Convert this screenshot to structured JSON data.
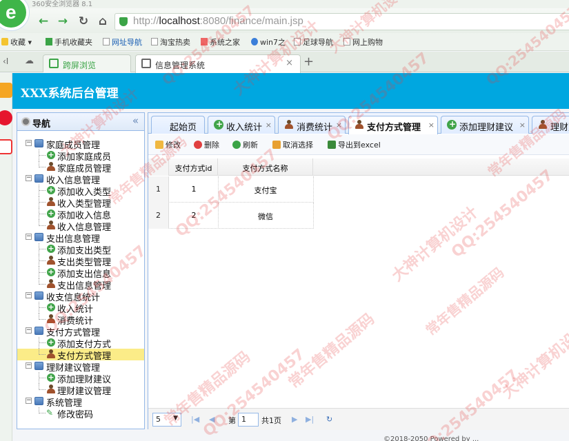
{
  "browser": {
    "title": "360安全浏览器 8.1",
    "url_prefix": "http://",
    "url_host": "localhost",
    "url_rest": ":8080/finance/main.jsp",
    "bookmarks": [
      "收藏",
      "手机收藏夹",
      "网址导航",
      "淘宝热卖",
      "系统之家",
      "win7之",
      "足球导航",
      "网上购物"
    ],
    "tabs": [
      {
        "label": "跨屏浏览"
      },
      {
        "label": "信息管理系统"
      }
    ],
    "new_tab": "+"
  },
  "app": {
    "title": "XXX系统后台管理",
    "nav": {
      "title": "导航",
      "collapse": "«",
      "groups": [
        {
          "label": "家庭成员管理",
          "items": [
            "添加家庭成员",
            "家庭成员管理"
          ]
        },
        {
          "label": "收入信息管理",
          "items": [
            "添加收入类型",
            "收入类型管理",
            "添加收入信息",
            "收入信息管理"
          ]
        },
        {
          "label": "支出信息管理",
          "items": [
            "添加支出类型",
            "支出类型管理",
            "添加支出信息",
            "支出信息管理"
          ]
        },
        {
          "label": "收支信息统计",
          "items": [
            "收入统计",
            "消费统计"
          ]
        },
        {
          "label": "支付方式管理",
          "items": [
            "添加支付方式",
            "支付方式管理"
          ]
        },
        {
          "label": "理财建议管理",
          "items": [
            "添加理财建议",
            "理财建议管理"
          ]
        },
        {
          "label": "系统管理",
          "items": [
            "修改密码"
          ]
        }
      ]
    },
    "tabs": [
      "起始页",
      "收入统计",
      "消费统计",
      "支付方式管理",
      "添加理财建议",
      "理财建"
    ],
    "toolbar": {
      "edit": "修改",
      "delete": "删除",
      "refresh": "刷新",
      "cancel_select": "取消选择",
      "export": "导出到excel"
    },
    "grid": {
      "columns": [
        "支付方式id",
        "支付方式名称"
      ],
      "rows": [
        {
          "num": "1",
          "id": "1",
          "name": "支付宝"
        },
        {
          "num": "2",
          "id": "2",
          "name": "微信"
        }
      ]
    },
    "pager": {
      "page_size": "5",
      "page_prefix": "第",
      "page": "1",
      "total": "共1页"
    },
    "footer": "©2018-2050 Powered by ..."
  },
  "watermark": {
    "texts": [
      "QQ:254540457",
      "大神计算机设计",
      "常年售精品源码"
    ]
  },
  "colors": {
    "header": "#00a7e0",
    "accent": "#3ba447",
    "border": "#95b8e7",
    "selected": "#fbec88"
  }
}
